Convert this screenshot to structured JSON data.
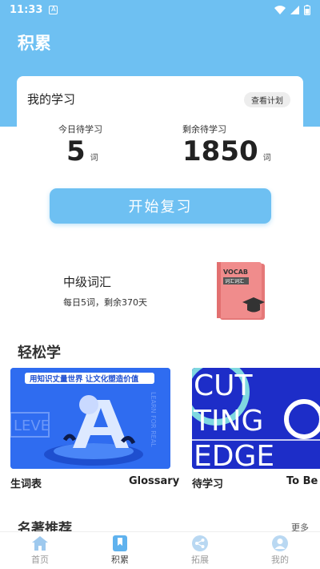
{
  "status": {
    "time": "11:33",
    "indicator": "A"
  },
  "header": {
    "title": "积累"
  },
  "study": {
    "title": "我的学习",
    "plan_label": "查看计划",
    "today": {
      "label": "今日待学习",
      "value": "5",
      "unit": "词"
    },
    "remaining": {
      "label": "剩余待学习",
      "value": "1850",
      "unit": "词"
    }
  },
  "review_button": "开始复习",
  "vocab": {
    "name": "中级词汇",
    "desc": "每日5词，剩余370天",
    "book_cover_text": "VOCAB",
    "book_sub_text": "词汇词汇"
  },
  "easy_learn": {
    "title": "轻松学",
    "cards": [
      {
        "name": "生词表",
        "english": "Glossary",
        "banner": "用知识丈量世界 让文化塑造价值"
      },
      {
        "name": "待学习",
        "english": "To Be S"
      }
    ]
  },
  "recommend": {
    "title": "名著推荐",
    "more": "更多"
  },
  "tabs": [
    {
      "label": "首页",
      "icon": "home-icon",
      "active": false
    },
    {
      "label": "积累",
      "icon": "bookmark-icon",
      "active": true
    },
    {
      "label": "拓展",
      "icon": "share-icon",
      "active": false
    },
    {
      "label": "我的",
      "icon": "user-icon",
      "active": false
    }
  ],
  "colors": {
    "primary": "#6EC0F2",
    "book": "#F08C8C"
  }
}
